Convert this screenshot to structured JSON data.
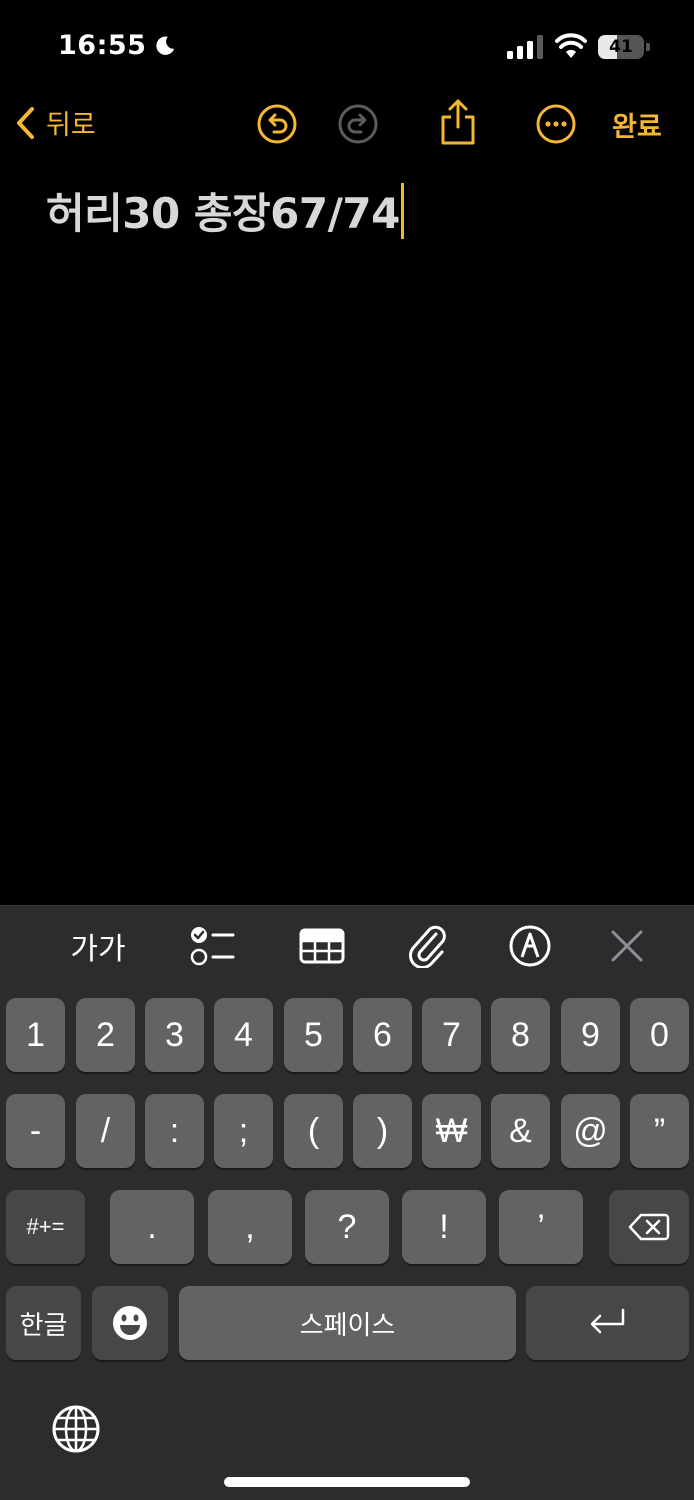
{
  "status": {
    "time": "16:55",
    "battery_level": 41,
    "battery_label": "41"
  },
  "nav": {
    "back_label": "뒤로",
    "done_label": "완료",
    "icons": [
      "undo-icon",
      "redo-icon",
      "share-icon",
      "more-icon"
    ]
  },
  "note": {
    "text": "허리30 총장67/74"
  },
  "toolbar": {
    "format_label": "가가",
    "icons": [
      "checklist-icon",
      "table-icon",
      "attachment-icon",
      "markup-icon",
      "close-icon"
    ]
  },
  "keyboard": {
    "row1": [
      "1",
      "2",
      "3",
      "4",
      "5",
      "6",
      "7",
      "8",
      "9",
      "0"
    ],
    "row2": [
      "-",
      "/",
      ":",
      ";",
      "(",
      ")",
      "₩",
      "&",
      "@",
      "”"
    ],
    "row3_mode": "#+=",
    "row3": [
      ".",
      ",",
      "?",
      "!",
      "’"
    ],
    "hangul_label": "한글",
    "space_label": "스페이스"
  },
  "colors": {
    "accent": "#f4b731",
    "background": "#000000",
    "keyboard_bg": "#2c2c2e",
    "key_bg": "#636366"
  }
}
